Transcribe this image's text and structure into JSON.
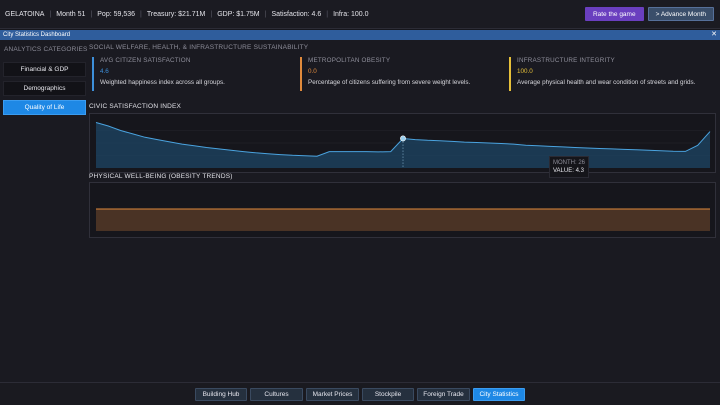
{
  "topbar": {
    "city": "GELATOINA",
    "month": "Month 51",
    "pop": "Pop: 59,536",
    "treasury": "Treasury: $21.71M",
    "gdp": "GDP: $1.75M",
    "satisfaction": "Satisfaction: 4.6",
    "infra": "Infra: 100.0",
    "rate_button": "Rate the game",
    "advance_button": "> Advance Month"
  },
  "window": {
    "title": "City Statistics Dashboard",
    "close_icon": "close-icon"
  },
  "sidebar": {
    "header": "ANALYTICS CATEGORIES",
    "items": [
      {
        "label": "Financial & GDP",
        "active": false
      },
      {
        "label": "Demographics",
        "active": false
      },
      {
        "label": "Quality of Life",
        "active": true
      }
    ]
  },
  "main": {
    "section_title": "SOCIAL WELFARE, HEALTH, & INFRASTRUCTURE SUSTAINABILITY",
    "kpis": [
      {
        "label": "AVG CITIZEN SATISFACTION",
        "value": "4.6",
        "desc": "Weighted happiness index across all groups.",
        "color": "#3d8fd9"
      },
      {
        "label": "METROPOLITAN OBESITY",
        "value": "0.0",
        "desc": "Percentage of citizens suffering from severe weight levels.",
        "color": "#e08a3c"
      },
      {
        "label": "INFRASTRUCTURE INTEGRITY",
        "value": "100.0",
        "desc": "Average physical health and wear condition of streets and grids.",
        "color": "#e6c03a"
      }
    ],
    "satisfaction_chart_title": "CIVIC SATISFACTION INDEX",
    "obesity_chart_title": "PHYSICAL WELL-BEING (OBESITY TRENDS)",
    "tooltip": {
      "month": "MONTH: 26",
      "value": "VALUE: 4.3"
    }
  },
  "chart_data": [
    {
      "type": "area",
      "title": "CIVIC SATISFACTION INDEX",
      "x": [
        1,
        2,
        3,
        4,
        5,
        6,
        7,
        8,
        9,
        10,
        11,
        12,
        13,
        14,
        15,
        16,
        17,
        18,
        19,
        20,
        21,
        22,
        23,
        24,
        25,
        26,
        27,
        28,
        29,
        30,
        31,
        32,
        33,
        34,
        35,
        36,
        37,
        38,
        39,
        40,
        41,
        42,
        43,
        44,
        45,
        46,
        47,
        48,
        49,
        50,
        51
      ],
      "values": [
        5.0,
        4.85,
        4.65,
        4.5,
        4.35,
        4.25,
        4.15,
        4.05,
        3.98,
        3.9,
        3.84,
        3.78,
        3.72,
        3.67,
        3.63,
        3.59,
        3.56,
        3.54,
        3.52,
        3.72,
        3.72,
        3.72,
        3.72,
        3.71,
        3.72,
        4.3,
        4.25,
        4.22,
        4.2,
        4.17,
        4.14,
        4.12,
        4.1,
        4.08,
        4.05,
        4.0,
        3.98,
        3.95,
        3.93,
        3.9,
        3.88,
        3.86,
        3.84,
        3.82,
        3.8,
        3.78,
        3.76,
        3.74,
        3.73,
        4.0,
        4.6
      ],
      "ylim": [
        3.0,
        5.2
      ],
      "highlight_month": 26,
      "color": "#4aa3df"
    },
    {
      "type": "area",
      "title": "PHYSICAL WELL-BEING (OBESITY TRENDS)",
      "x": [
        1,
        51
      ],
      "values": [
        0.0,
        0.0
      ],
      "color": "#e08a3c"
    }
  ],
  "bottom_tabs": [
    {
      "label": "Building Hub",
      "active": false
    },
    {
      "label": "Cultures",
      "active": false
    },
    {
      "label": "Market Prices",
      "active": false
    },
    {
      "label": "Stockpile",
      "active": false
    },
    {
      "label": "Foreign Trade",
      "active": false
    },
    {
      "label": "City Statistics",
      "active": true
    }
  ]
}
